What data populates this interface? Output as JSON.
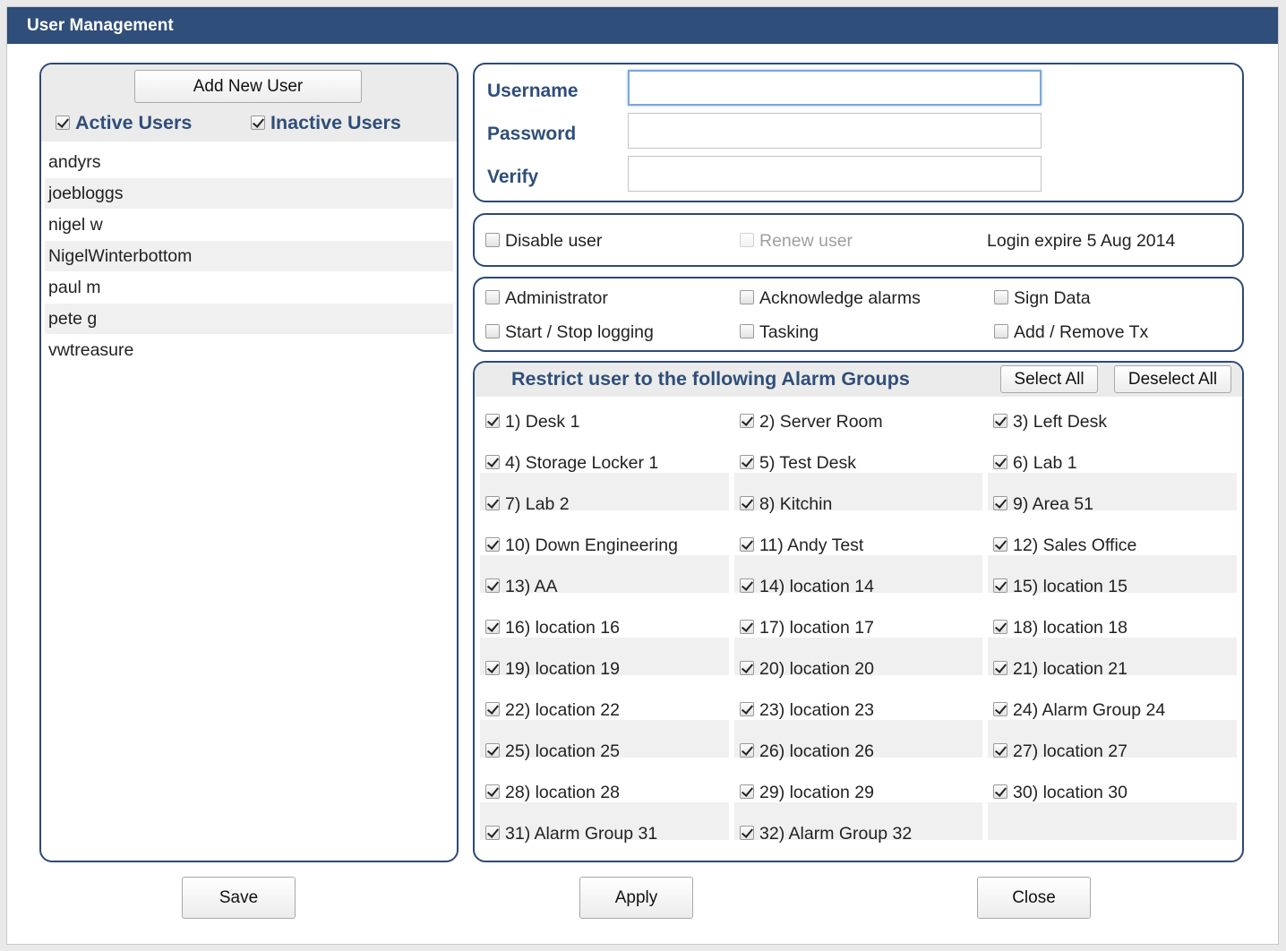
{
  "window": {
    "title": "User Management"
  },
  "users_panel": {
    "add_button": "Add New User",
    "filters": [
      {
        "label": "Active Users",
        "checked": true
      },
      {
        "label": "Inactive Users",
        "checked": true
      }
    ],
    "users": [
      "andyrs",
      "joebloggs",
      "nigel w",
      "NigelWinterbottom",
      "paul m",
      "pete g",
      "vwtreasure"
    ]
  },
  "credentials": {
    "username_label": "Username",
    "password_label": "Password",
    "verify_label": "Verify",
    "username_value": "",
    "password_value": "",
    "verify_value": ""
  },
  "status": {
    "disable_label": "Disable user",
    "disable_checked": false,
    "renew_label": "Renew user",
    "renew_checked": false,
    "renew_enabled": false,
    "expire_text": "Login expire 5 Aug 2014"
  },
  "permissions": [
    {
      "label": "Administrator",
      "checked": false
    },
    {
      "label": "Acknowledge alarms",
      "checked": false
    },
    {
      "label": "Sign Data",
      "checked": false
    },
    {
      "label": "Start / Stop logging",
      "checked": false
    },
    {
      "label": "Tasking",
      "checked": false
    },
    {
      "label": "Add / Remove Tx",
      "checked": false
    }
  ],
  "alarm_groups": {
    "title": "Restrict user to the following Alarm Groups",
    "select_all": "Select All",
    "deselect_all": "Deselect All",
    "items": [
      "1) Desk 1",
      "2) Server Room",
      "3) Left Desk",
      "4) Storage Locker 1",
      "5) Test Desk",
      "6) Lab 1",
      "7) Lab 2",
      "8) Kitchin",
      "9) Area 51",
      "10) Down Engineering",
      "11) Andy Test",
      "12) Sales Office",
      "13) AA",
      "14) location 14",
      "15) location 15",
      "16) location 16",
      "17) location 17",
      "18) location 18",
      "19) location 19",
      "20) location 20",
      "21) location 21",
      "22) location 22",
      "23) location 23",
      "24) Alarm Group 24",
      "25) location 25",
      "26) location 26",
      "27) location 27",
      "28) location 28",
      "29) location 29",
      "30) location 30",
      "31) Alarm Group 31",
      "32) Alarm Group 32"
    ],
    "all_checked": true
  },
  "footer": {
    "save": "Save",
    "apply": "Apply",
    "close": "Close"
  }
}
